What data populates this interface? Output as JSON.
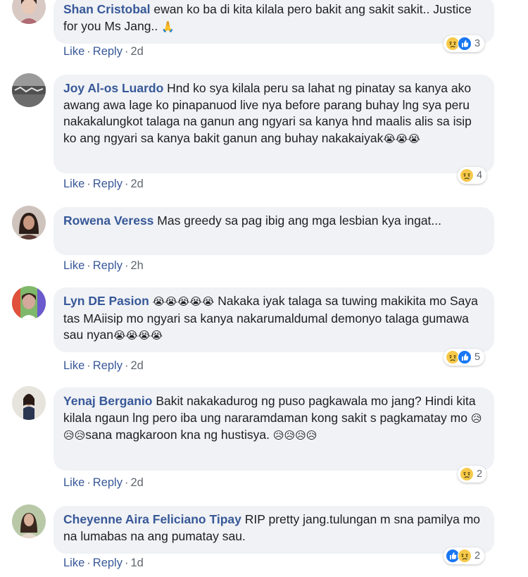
{
  "comments": [
    {
      "author": "Shan Cristobal",
      "text": "ewan ko ba di kita kilala pero bakit ang sakit sakit.. Justice for you Ms Jang..",
      "emoji_suffix": "🙏",
      "reaction_count": "3",
      "reactions": [
        "sad",
        "like"
      ],
      "like_label": "Like",
      "reply_label": "Reply",
      "time": "2d"
    },
    {
      "author": "Joy Al-os Luardo",
      "text": "Hnd ko sya kilala peru sa lahat ng pinatay sa kanya ako awang awa lage ko pinapanuod live nya before parang buhay lng sya peru nakakalungkot talaga na ganun ang ngyari sa kanya hnd maalis alis sa isip ko ang ngyari sa kanya bakit ganun ang buhay nakakaiyak",
      "emoji_suffix": "😭😭😭",
      "reaction_count": "4",
      "reactions": [
        "sad"
      ],
      "like_label": "Like",
      "reply_label": "Reply",
      "time": "2d"
    },
    {
      "author": "Rowena Veress",
      "text": "Mas greedy sa pag ibig ang mga lesbian kya ingat...",
      "emoji_suffix": "",
      "like_label": "Like",
      "reply_label": "Reply",
      "time": "2h"
    },
    {
      "author": "Lyn DE Pasion",
      "name_emoji": "😭😭😭😭😭",
      "text": "Nakaka iyak talaga sa tuwing makikita mo Saya tas MAiisip mo ngyari sa kanya nakarumaldumal demonyo talaga gumawa sau nyan",
      "emoji_suffix": "😭😭😭😭",
      "reaction_count": "5",
      "reactions": [
        "sad",
        "like"
      ],
      "like_label": "Like",
      "reply_label": "Reply",
      "time": "2d"
    },
    {
      "author": "Yenaj Berganio",
      "text": "Bakit nakakadurog ng puso pagkawala mo jang? Hindi kita kilala ngaun lng pero iba ung nararamdaman kong sakit s pagkamatay mo",
      "mid_emoji": "😥😥😥",
      "text2": "sana magkaroon kna ng hustisya.",
      "emoji_suffix": "😥😥😥😥",
      "reaction_count": "2",
      "reactions": [
        "sad"
      ],
      "like_label": "Like",
      "reply_label": "Reply",
      "time": "2d"
    },
    {
      "author": "Cheyenne Aira Feliciano Tipay",
      "text": "RIP pretty jang.tulungan m sna pamilya mo na lumabas na ang pumatay sau.",
      "emoji_suffix": "",
      "reaction_count": "2",
      "reactions": [
        "like",
        "sad"
      ],
      "like_label": "Like",
      "reply_label": "Reply",
      "time": "1d"
    }
  ],
  "colors": {
    "name": "#385898",
    "bubble": "#f0f2f5",
    "meta": "#606770",
    "like_blue": "#1877f2",
    "sad_yellow": "#f7c94a"
  }
}
